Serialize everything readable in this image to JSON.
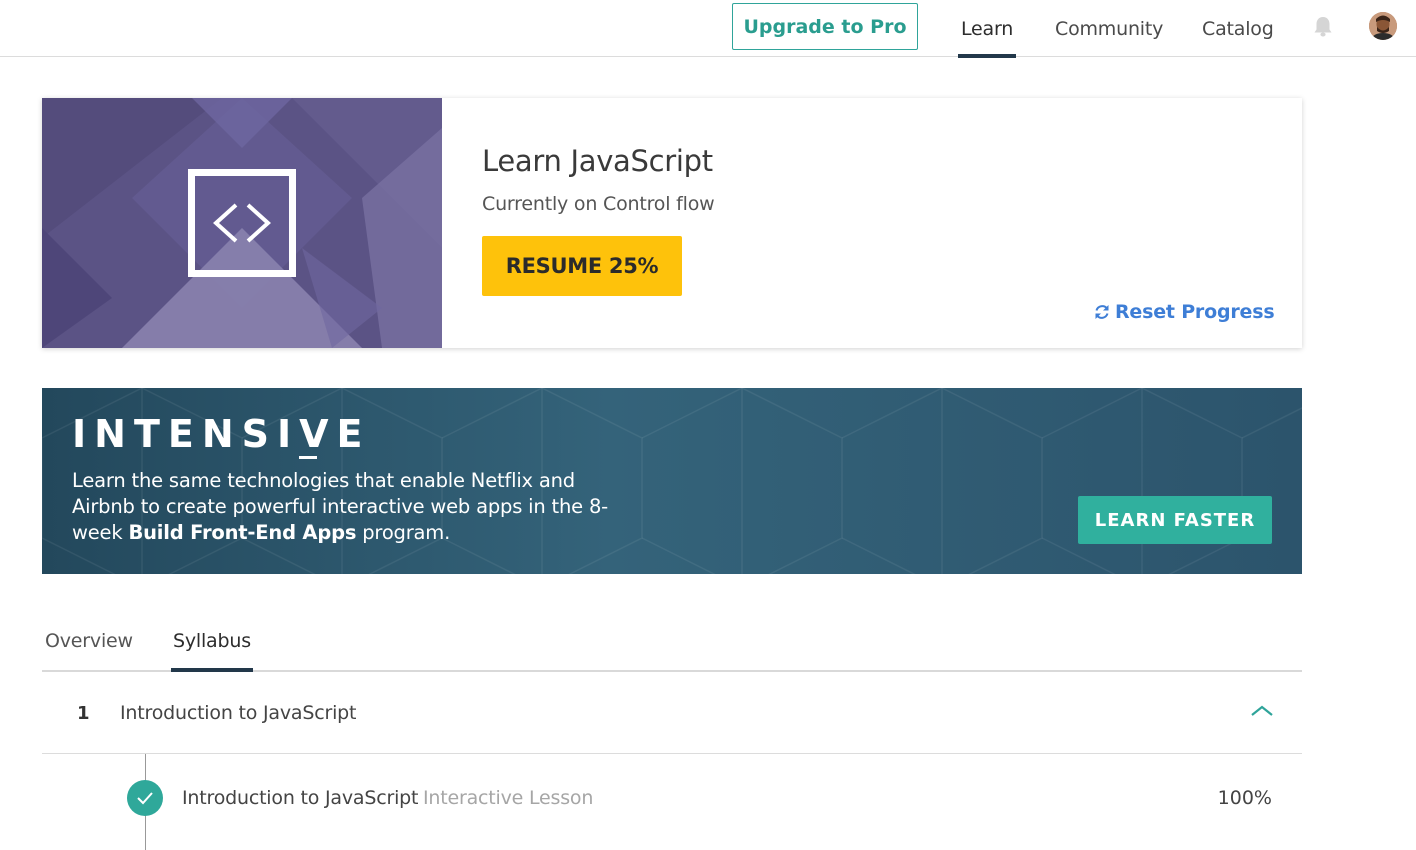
{
  "nav": {
    "upgrade_label": "Upgrade to Pro",
    "links": [
      "Learn",
      "Community",
      "Catalog"
    ],
    "active": "Learn"
  },
  "course": {
    "title": "Learn JavaScript",
    "subtitle": "Currently on Control flow",
    "resume_label": "RESUME 25%",
    "progress_percent": 25,
    "reset_label": "Reset Progress"
  },
  "banner": {
    "brand": "INTENSIVE",
    "text_part1": "Learn the same technologies that enable Netflix and Airbnb to create powerful interactive web apps in the 8-week ",
    "text_bold": "Build Front-End Apps",
    "text_part2": " program.",
    "cta_label": "LEARN FASTER"
  },
  "tabs": {
    "overview": "Overview",
    "syllabus": "Syllabus",
    "active": "Syllabus"
  },
  "syllabus": {
    "module": {
      "number": "1",
      "title": "Introduction to JavaScript"
    },
    "lesson": {
      "title": "Introduction to JavaScript",
      "type": "Interactive Lesson",
      "progress": "100%"
    }
  },
  "colors": {
    "accent_teal": "#2fa49a",
    "resume_yellow": "#fec20b",
    "link_blue": "#3e7ed6",
    "nav_underline": "#22384a"
  }
}
